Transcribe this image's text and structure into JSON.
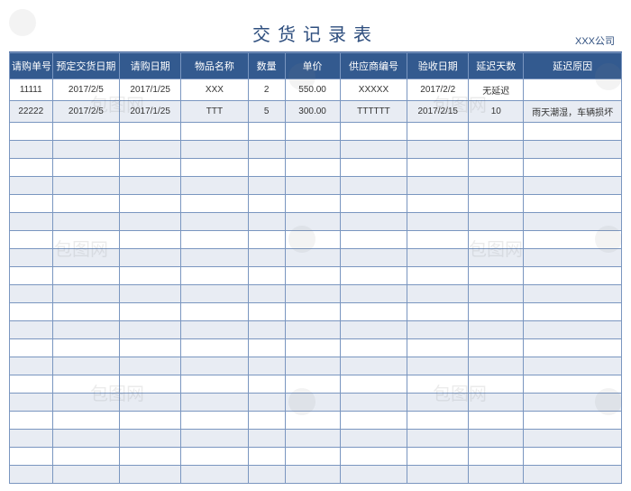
{
  "title": "交货记录表",
  "company": "XXX公司",
  "headers": [
    "请购单号",
    "预定交货日期",
    "请购日期",
    "物品名称",
    "数量",
    "单价",
    "供应商编号",
    "验收日期",
    "延迟天数",
    "延迟原因"
  ],
  "rows": [
    [
      "11111",
      "2017/2/5",
      "2017/1/25",
      "XXX",
      "2",
      "550.00",
      "XXXXX",
      "2017/2/2",
      "无延迟",
      ""
    ],
    [
      "22222",
      "2017/2/5",
      "2017/1/25",
      "TTT",
      "5",
      "300.00",
      "TTTTTT",
      "2017/2/15",
      "10",
      "雨天潮湿，车辆损坏"
    ]
  ],
  "empty_row_count": 20,
  "watermark_text": "包图网"
}
